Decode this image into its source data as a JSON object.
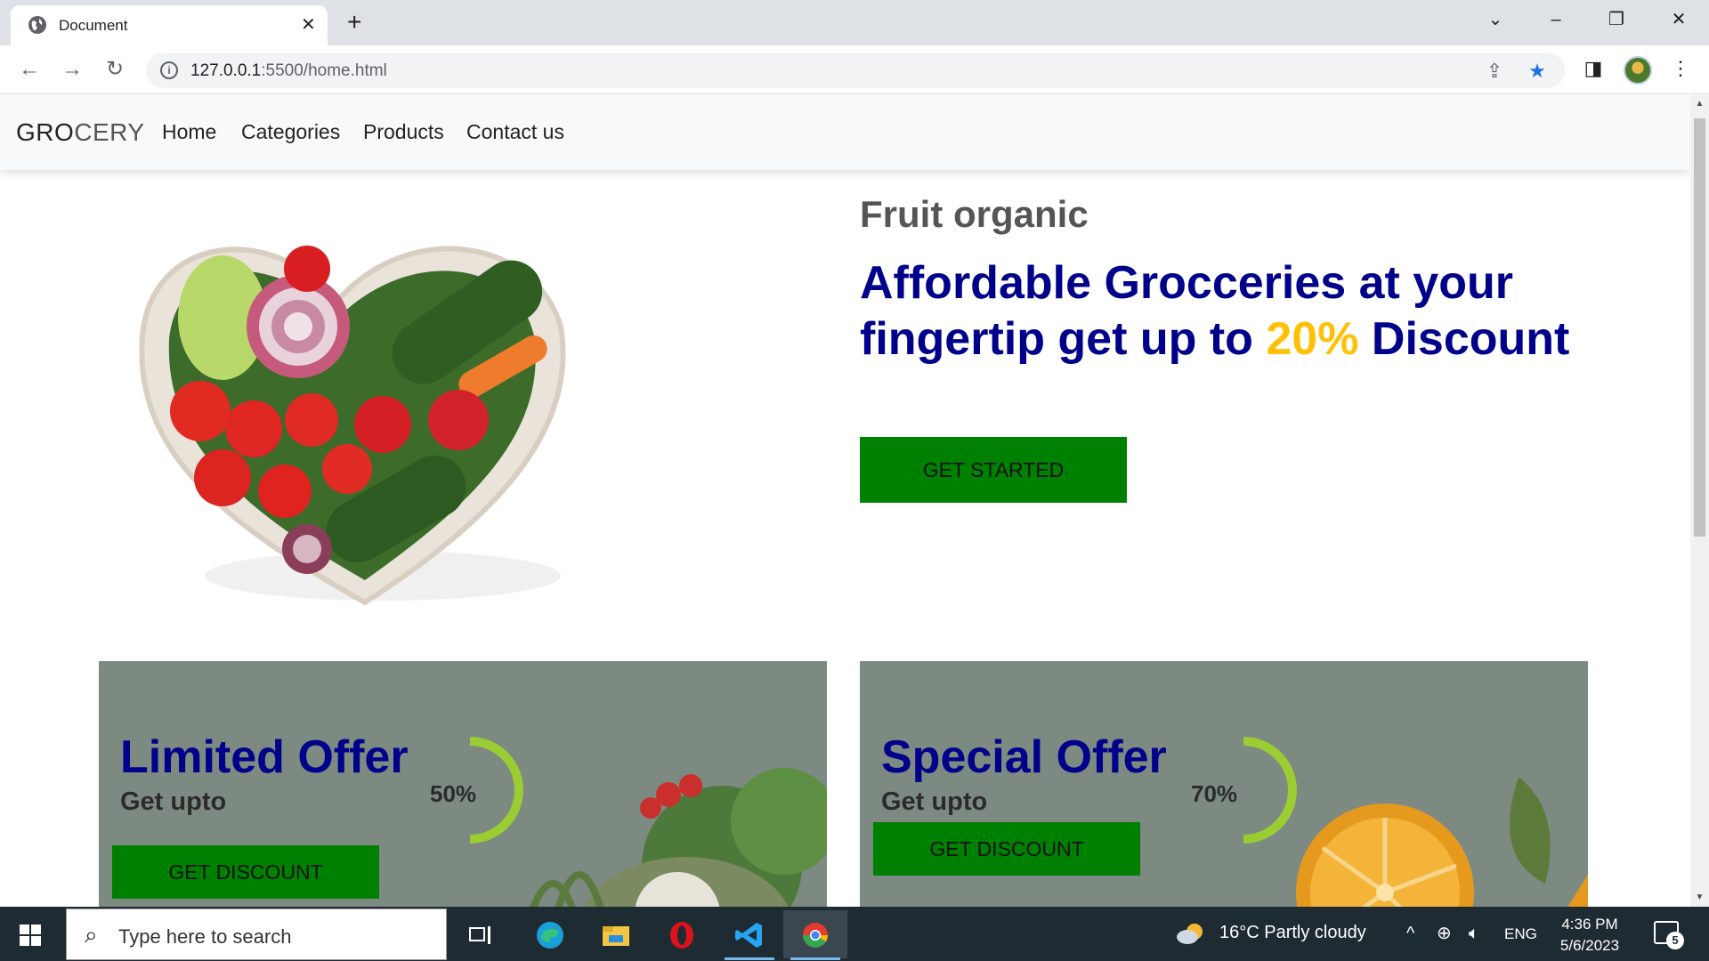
{
  "browser": {
    "tab_title": "Document",
    "url_host": "127.0.0.1",
    "url_path": ":5500/home.html",
    "icons": [
      "globe-icon",
      "close-icon",
      "plus-icon",
      "chevron-down-icon",
      "minimize-icon",
      "restore-icon",
      "back-icon",
      "forward-icon",
      "reload-icon",
      "info-icon",
      "share-icon",
      "star-icon",
      "side-panel-icon",
      "avatar",
      "kebab-menu-icon"
    ]
  },
  "site": {
    "brand_1": "GRO",
    "brand_2": "CERY",
    "nav": [
      "Home",
      "Categories",
      "Products",
      "Contact us"
    ]
  },
  "hero": {
    "subtitle": "Fruit organic",
    "title_1": "Affordable Grocceries at your fingertip get up to ",
    "title_accent": "20%",
    "title_2": " Discount",
    "button": "GET STARTED"
  },
  "offers": [
    {
      "title": "Limited Offer",
      "subtitle": "Get upto",
      "percent": "50%",
      "button": "GET DISCOUNT"
    },
    {
      "title": "Special Offer",
      "subtitle": "Get upto",
      "percent": "70%",
      "button": "GET DISCOUNT"
    }
  ],
  "taskbar": {
    "search_placeholder": "Type here to search",
    "weather": "16°C  Partly cloudy",
    "lang": "ENG",
    "time": "4:36 PM",
    "date": "5/6/2023",
    "notifications": "5"
  },
  "colors": {
    "brand_blue": "#00008b",
    "accent_yellow": "#ffc107",
    "button_green": "#008000",
    "ring_green": "#9acd32"
  }
}
